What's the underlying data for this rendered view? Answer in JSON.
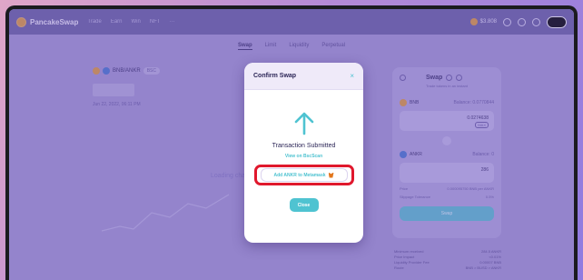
{
  "nav": {
    "brand": "PancakeSwap",
    "links": [
      "Trade",
      "Earn",
      "Win",
      "NFT",
      "···"
    ],
    "price": "$3.808"
  },
  "subtabs": [
    "Swap",
    "Limit",
    "Liquidity",
    "Perpetual"
  ],
  "chart": {
    "pair": "BNB/ANKR",
    "badge": "BSC",
    "date": "Jun 22, 2022, 06:11 PM",
    "loading": "Loading chart"
  },
  "swap": {
    "title": "Swap",
    "subtitle": "Trade tokens in an instant",
    "from_token": "BNB",
    "from_balance": "Balance: 0.0770844",
    "from_amount": "0.0274638",
    "max_label": "MAX",
    "to_token": "ANKR",
    "to_balance": "Balance: 0",
    "to_amount": "286",
    "price_label": "Price",
    "price_value": "0.000095750 BNB per ANKR",
    "slippage_label": "Slippage Tolerance",
    "slippage_value": "0.5%",
    "button": "Swap"
  },
  "stats": [
    {
      "label": "Minimum received",
      "value": "284.5 ANKR"
    },
    {
      "label": "Price Impact",
      "value": "<0.01%"
    },
    {
      "label": "Liquidity Provider Fee",
      "value": "0.00007 BNB"
    },
    {
      "label": "Route",
      "value": "BNB > BUSD > ANKR"
    }
  ],
  "modal": {
    "title": "Confirm Swap",
    "close_symbol": "×",
    "status": "Transaction Submitted",
    "explorer_link": "View on BscScan",
    "add_token": "Add ANKR to Metamask",
    "close_button": "Close"
  },
  "colors": {
    "accent": "#4fc3d1",
    "highlight": "#e0182d",
    "background": "#a99cd9"
  }
}
